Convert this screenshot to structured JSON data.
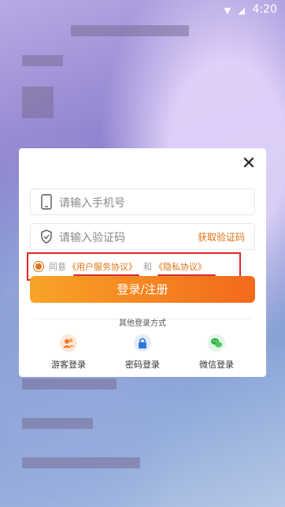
{
  "status_bar": {
    "time": "4:20"
  },
  "dialog": {
    "close_icon": "close-icon",
    "phone_field": {
      "placeholder": "请输入手机号",
      "icon": "phone-icon"
    },
    "code_field": {
      "placeholder": "请输入验证码",
      "icon": "shield-check-icon",
      "get_code": "获取验证码"
    },
    "agreement": {
      "prefix": "同意",
      "user_agreement": "《用户服务协议》",
      "connector": "和",
      "privacy": "《隐私协议》",
      "checked": true
    },
    "login_button": "登录/注册",
    "other_login": {
      "title": "其他登录方式",
      "options": [
        {
          "label": "游客登录",
          "icon": "guest-icon"
        },
        {
          "label": "密码登录",
          "icon": "lock-icon"
        },
        {
          "label": "微信登录",
          "icon": "wechat-icon"
        }
      ]
    }
  },
  "colors": {
    "accent": "#e27316",
    "highlight": "#e2252b"
  }
}
